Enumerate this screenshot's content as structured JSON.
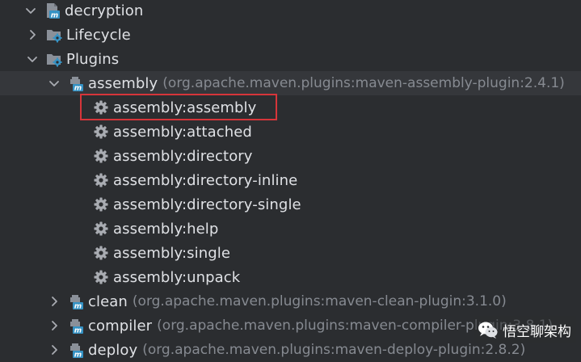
{
  "tree": {
    "root": {
      "label": "decryption",
      "expanded": true,
      "icon": "maven-module-icon"
    },
    "lifecycle": {
      "label": "Lifecycle",
      "expanded": false,
      "icon": "folder-gear-icon"
    },
    "plugins": {
      "label": "Plugins",
      "expanded": true,
      "icon": "folder-gear-icon"
    },
    "assembly": {
      "label": "assembly",
      "coords": "(org.apache.maven.plugins:maven-assembly-plugin:2.4.1)",
      "expanded": true,
      "icon": "maven-plugin-icon",
      "goals": [
        {
          "label": "assembly:assembly",
          "icon": "gear-icon",
          "highlighted": true
        },
        {
          "label": "assembly:attached",
          "icon": "gear-icon"
        },
        {
          "label": "assembly:directory",
          "icon": "gear-icon"
        },
        {
          "label": "assembly:directory-inline",
          "icon": "gear-icon"
        },
        {
          "label": "assembly:directory-single",
          "icon": "gear-icon"
        },
        {
          "label": "assembly:help",
          "icon": "gear-icon"
        },
        {
          "label": "assembly:single",
          "icon": "gear-icon"
        },
        {
          "label": "assembly:unpack",
          "icon": "gear-icon"
        }
      ]
    },
    "clean": {
      "label": "clean",
      "coords": "(org.apache.maven.plugins:maven-clean-plugin:3.1.0)",
      "expanded": false,
      "icon": "maven-plugin-icon"
    },
    "compiler": {
      "label": "compiler",
      "coords": "(org.apache.maven.plugins:maven-compiler-plugin:3.8.1)",
      "expanded": false,
      "icon": "maven-plugin-icon"
    },
    "deploy": {
      "label": "deploy",
      "coords": "(org.apache.maven.plugins:maven-deploy-plugin:2.8.2)",
      "expanded": false,
      "icon": "maven-plugin-icon"
    }
  },
  "watermark": {
    "text": "悟空聊架构",
    "icon": "wechat-logo-icon"
  },
  "colors": {
    "background": "#2b2d30",
    "selected_row": "#35373b",
    "text": "#dfe1e5",
    "muted_text": "#868a91",
    "highlight_border": "#d6353a",
    "maven_blue": "#3592c4",
    "gear": "#a9acb2"
  }
}
